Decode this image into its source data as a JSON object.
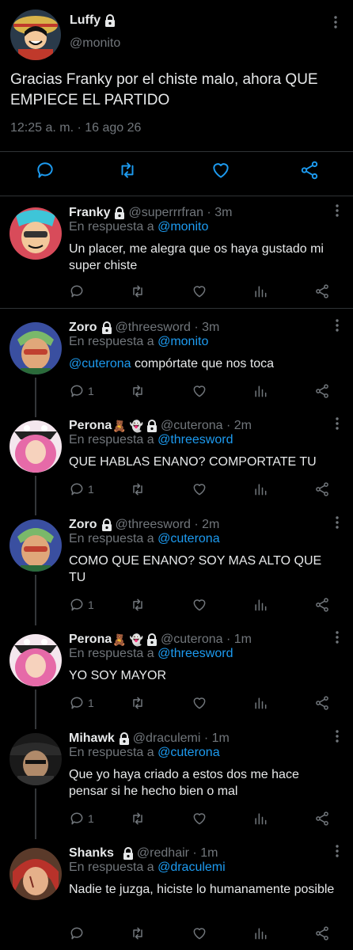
{
  "main_tweet": {
    "name": "Luffy",
    "handle": "@monito",
    "text": "Gracias Franky por el chiste malo, ahora QUE EMPIECE EL PARTIDO",
    "time": "12:25 a. m. · 16 ago 26",
    "avatar_icon": "luffy-avatar"
  },
  "replies": [
    {
      "name": "Franky",
      "emoji": "",
      "handle": "@superrrfran",
      "time": "3m",
      "reply_prefix": "En respuesta a",
      "reply_to": "@monito",
      "mention": "",
      "text": "Un placer, me alegra que os haya gustado mi super chiste",
      "reply_count": "",
      "avatar_icon": "franky-avatar"
    },
    {
      "name": "Zoro",
      "emoji": "",
      "handle": "@threesword",
      "time": "3m",
      "reply_prefix": "En respuesta a",
      "reply_to": "@monito",
      "mention": "@cuterona",
      "text": "compórtate que nos toca",
      "reply_count": "1",
      "avatar_icon": "zoro-avatar"
    },
    {
      "name": "Perona",
      "emoji": "🧸 👻",
      "handle": "@cuterona",
      "time": "2m",
      "reply_prefix": "En respuesta a",
      "reply_to": "@threesword",
      "mention": "",
      "text": "QUE HABLAS ENANO? COMPORTATE TU",
      "reply_count": "1",
      "avatar_icon": "perona-avatar"
    },
    {
      "name": "Zoro",
      "emoji": "",
      "handle": "@threesword",
      "time": "2m",
      "reply_prefix": "En respuesta a",
      "reply_to": "@cuterona",
      "mention": "",
      "text": "COMO QUE ENANO? SOY MAS ALTO QUE TU",
      "reply_count": "1",
      "avatar_icon": "zoro-avatar"
    },
    {
      "name": "Perona",
      "emoji": "🧸 👻",
      "handle": "@cuterona",
      "time": "1m",
      "reply_prefix": "En respuesta a",
      "reply_to": "@threesword",
      "mention": "",
      "text": "YO SOY MAYOR",
      "reply_count": "1",
      "avatar_icon": "perona-avatar"
    },
    {
      "name": "Mihawk",
      "emoji": "",
      "handle": "@draculemi",
      "time": "1m",
      "reply_prefix": "En respuesta a",
      "reply_to": "@cuterona",
      "mention": "",
      "text": "Que yo haya criado a estos dos me hace pensar si he hecho bien o mal",
      "reply_count": "1",
      "avatar_icon": "mihawk-avatar"
    },
    {
      "name": "Shanks",
      "emoji": "",
      "handle": "@redhair",
      "time": "1m",
      "reply_prefix": "En respuesta a",
      "reply_to": "@draculemi",
      "mention": "",
      "text": "Nadie te juzga, hiciste lo humanamente posible",
      "reply_count": "",
      "avatar_icon": "shanks-avatar"
    }
  ],
  "colors": {
    "background": "#000000",
    "text": "#e7e9ea",
    "muted": "#71767b",
    "link": "#1d9bf0",
    "divider": "#2f3336"
  }
}
